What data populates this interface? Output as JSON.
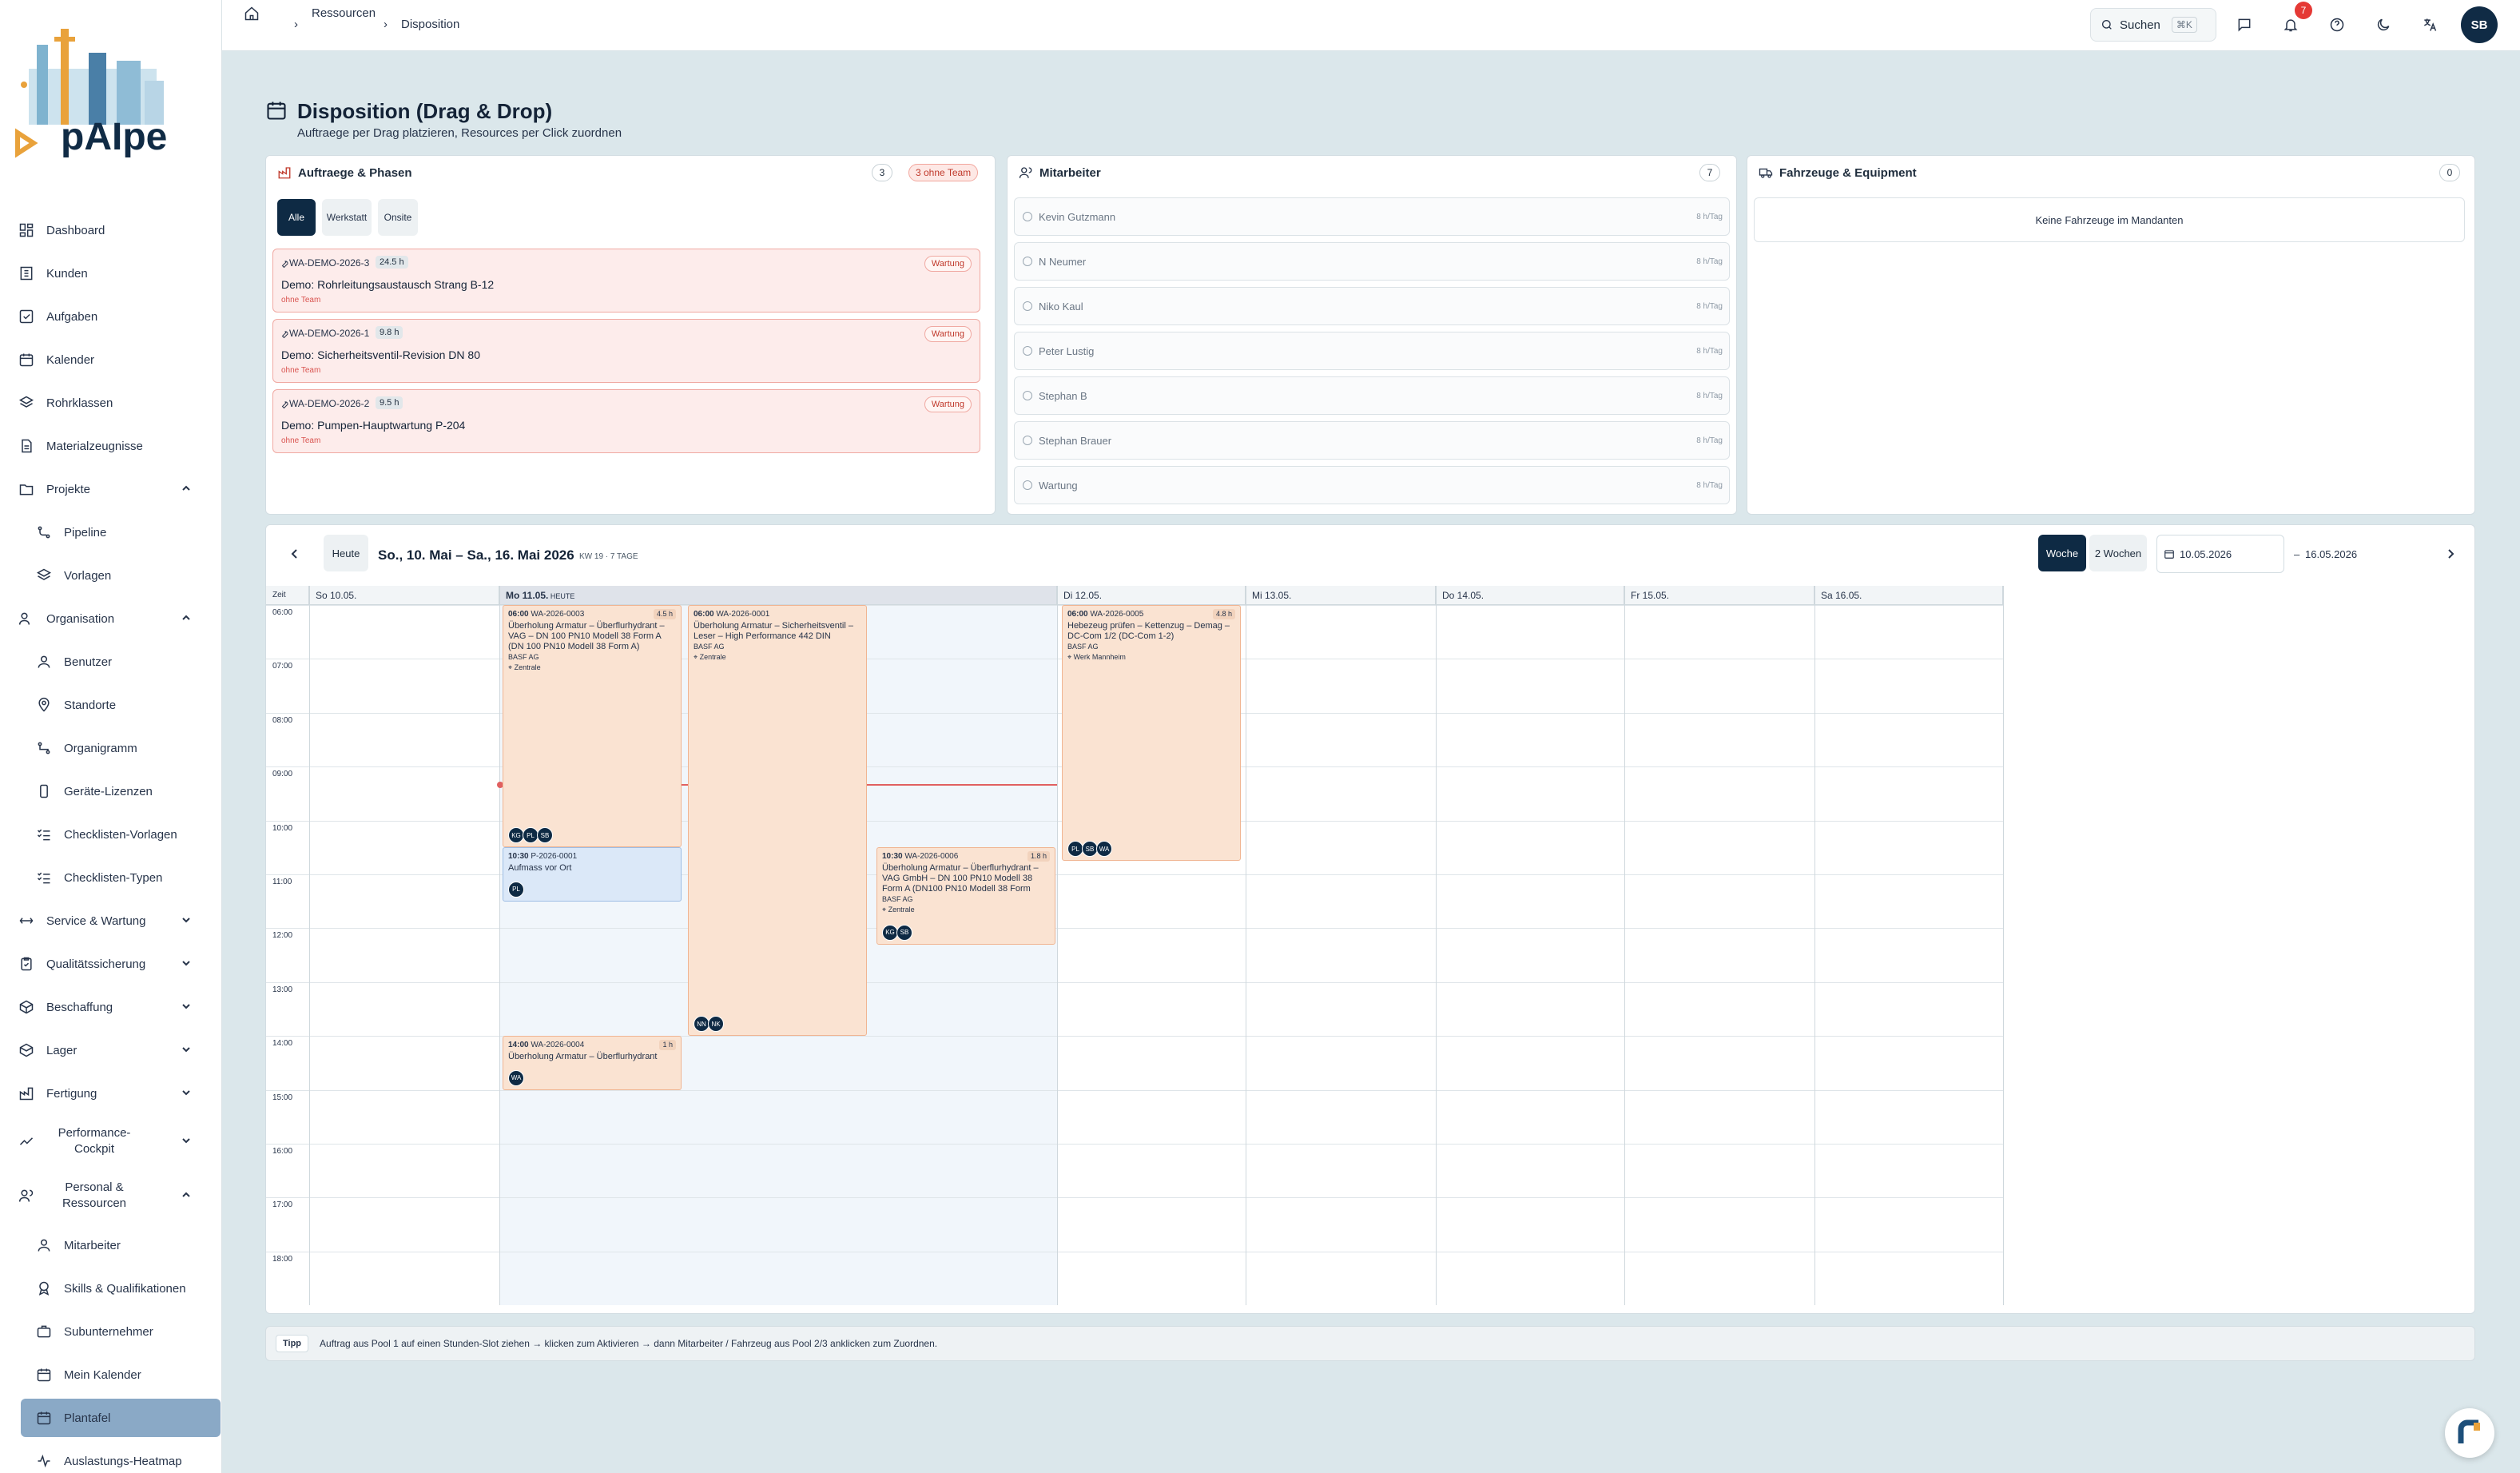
{
  "brand": {
    "name": "pAIpe"
  },
  "sidebar": {
    "items": [
      {
        "label": "Dashboard",
        "icon": "dashboard-icon"
      },
      {
        "label": "Kunden",
        "icon": "customers-icon"
      },
      {
        "label": "Aufgaben",
        "icon": "tasks-icon"
      },
      {
        "label": "Kalender",
        "icon": "calendar-icon"
      },
      {
        "label": "Rohrklassen",
        "icon": "layers-icon"
      },
      {
        "label": "Materialzeugnisse",
        "icon": "document-icon"
      },
      {
        "label": "Projekte",
        "icon": "folder-icon"
      },
      {
        "label": "Pipeline",
        "icon": "pipeline-icon"
      },
      {
        "label": "Vorlagen",
        "icon": "layers-icon"
      },
      {
        "label": "Organisation",
        "icon": "org-icon"
      },
      {
        "label": "Benutzer",
        "icon": "user-icon"
      },
      {
        "label": "Standorte",
        "icon": "location-icon"
      },
      {
        "label": "Organigramm",
        "icon": "orgchart-icon"
      },
      {
        "label": "Geräte-Lizenzen",
        "icon": "device-icon"
      },
      {
        "label": "Checklisten-Vorlagen",
        "icon": "checklist-icon"
      },
      {
        "label": "Checklisten-Typen",
        "icon": "checklist-icon"
      },
      {
        "label": "Service & Wartung",
        "icon": "service-icon"
      },
      {
        "label": "Qualitätssicherung",
        "icon": "clipboard-icon"
      },
      {
        "label": "Beschaffung",
        "icon": "package-icon"
      },
      {
        "label": "Lager",
        "icon": "box-icon"
      },
      {
        "label": "Fertigung",
        "icon": "factory-icon"
      },
      {
        "label": "Performance-Cockpit",
        "icon": "trend-icon"
      },
      {
        "label": "Personal & Ressourcen",
        "icon": "people-icon"
      },
      {
        "label": "Mitarbeiter",
        "icon": "user-icon"
      },
      {
        "label": "Skills & Qualifikationen",
        "icon": "award-icon"
      },
      {
        "label": "Subunternehmer",
        "icon": "briefcase-icon"
      },
      {
        "label": "Mein Kalender",
        "icon": "calendar-icon"
      },
      {
        "label": "Plantafel",
        "icon": "calendar-icon"
      },
      {
        "label": "Auslastungs-Heatmap",
        "icon": "activity-icon"
      }
    ]
  },
  "topbar": {
    "breadcrumb": [
      "Ressourcen",
      "Disposition"
    ],
    "search_label": "Suchen",
    "search_shortcut": "⌘K",
    "notification_count": "7",
    "avatar_initials": "SB"
  },
  "page": {
    "title": "Disposition (Drag & Drop)",
    "subtitle": "Auftraege per Drag platzieren, Resources per Click zuordnen"
  },
  "orders_panel": {
    "title": "Auftraege & Phasen",
    "count": "3",
    "warning": "3 ohne Team",
    "tabs": [
      "Alle",
      "Werkstatt",
      "Onsite"
    ],
    "items": [
      {
        "code": "WA-DEMO-2026-3",
        "hours": "24.5 h",
        "title": "Demo: Rohrleitungsaustausch Strang B-12",
        "team": "ohne Team",
        "tag": "Wartung"
      },
      {
        "code": "WA-DEMO-2026-1",
        "hours": "9.8 h",
        "title": "Demo: Sicherheitsventil-Revision DN 80",
        "team": "ohne Team",
        "tag": "Wartung"
      },
      {
        "code": "WA-DEMO-2026-2",
        "hours": "9.5 h",
        "title": "Demo: Pumpen-Hauptwartung P-204",
        "team": "ohne Team",
        "tag": "Wartung"
      }
    ]
  },
  "staff_panel": {
    "title": "Mitarbeiter",
    "count": "7",
    "items": [
      {
        "name": "Kevin Gutzmann",
        "capacity": "8 h/Tag"
      },
      {
        "name": "N Neumer",
        "capacity": "8 h/Tag"
      },
      {
        "name": "Niko Kaul",
        "capacity": "8 h/Tag"
      },
      {
        "name": "Peter Lustig",
        "capacity": "8 h/Tag"
      },
      {
        "name": "Stephan B",
        "capacity": "8 h/Tag"
      },
      {
        "name": "Stephan Brauer",
        "capacity": "8 h/Tag"
      },
      {
        "name": "Wartung",
        "capacity": "8 h/Tag"
      }
    ]
  },
  "vehicle_panel": {
    "title": "Fahrzeuge & Equipment",
    "count": "0",
    "empty": "Keine Fahrzeuge im Mandanten"
  },
  "calendar": {
    "range": "So., 10. Mai – Sa., 16. Mai 2026",
    "kw": "KW 19 · 7 TAGE",
    "today_btn": "Heute",
    "view_week": "Woche",
    "view_two_weeks": "2 Wochen",
    "date_from": "10.05.2026",
    "date_sep": "–",
    "date_to": "16.05.2026",
    "time_header": "Zeit",
    "days": [
      {
        "label": "So 10.05.",
        "today": false
      },
      {
        "label": "Mo 11.05.",
        "today": true,
        "today_label": "HEUTE"
      },
      {
        "label": "Di 12.05.",
        "today": false
      },
      {
        "label": "Mi 13.05.",
        "today": false
      },
      {
        "label": "Do 14.05.",
        "today": false
      },
      {
        "label": "Fr 15.05.",
        "today": false
      },
      {
        "label": "Sa 16.05.",
        "today": false
      }
    ],
    "hours": [
      "06:00",
      "07:00",
      "08:00",
      "09:00",
      "10:00",
      "11:00",
      "12:00",
      "13:00",
      "14:00",
      "15:00",
      "16:00",
      "17:00",
      "18:00"
    ],
    "events": [
      {
        "time": "06:00",
        "code": "WA-2026-0003",
        "duration": "4.5 h",
        "title": "Überholung Armatur – Überflurhydrant – VAG – DN 100 PN10 Modell 38 Form A (DN 100 PN10 Modell 38 Form A)",
        "customer": "BASF AG",
        "location": "Zentrale",
        "chips": [
          "KG",
          "PL",
          "SB"
        ]
      },
      {
        "time": "06:00",
        "code": "WA-2026-0001",
        "duration": "",
        "title": "Überholung Armatur – Sicherheitsventil – Leser – High Performance 442 DIN",
        "customer": "BASF AG",
        "location": "Zentrale",
        "chips": [
          "NN",
          "NK"
        ]
      },
      {
        "time": "06:00",
        "code": "WA-2026-0005",
        "duration": "4.8 h",
        "title": "Hebezeug prüfen – Kettenzug – Demag – DC-Com 1/2 (DC-Com 1-2)",
        "customer": "BASF AG",
        "location": "Werk Mannheim",
        "chips": [
          "PL",
          "SB",
          "WA"
        ]
      },
      {
        "time": "10:30",
        "code": "P-2026-0001",
        "duration": "",
        "title": "Aufmass vor Ort",
        "customer": "",
        "location": "",
        "chips": [
          "PL"
        ]
      },
      {
        "time": "10:30",
        "code": "WA-2026-0006",
        "duration": "1.8 h",
        "title": "Überholung Armatur – Überflurhydrant – VAG GmbH – DN 100 PN10 Modell 38 Form A (DN100 PN10 Modell 38 Form",
        "customer": "BASF AG",
        "location": "Zentrale",
        "chips": [
          "KG",
          "SB"
        ]
      },
      {
        "time": "14:00",
        "code": "WA-2026-0004",
        "duration": "1 h",
        "title": "Überholung Armatur – Überflurhydrant",
        "customer": "",
        "location": "",
        "chips": [
          "WA"
        ]
      }
    ]
  },
  "tip": {
    "label": "Tipp",
    "text": "Auftrag aus Pool 1 auf einen Stunden-Slot ziehen → klicken zum Aktivieren → dann Mitarbeiter / Fahrzeug aus Pool 2/3 anklicken zum Zuordnen."
  }
}
